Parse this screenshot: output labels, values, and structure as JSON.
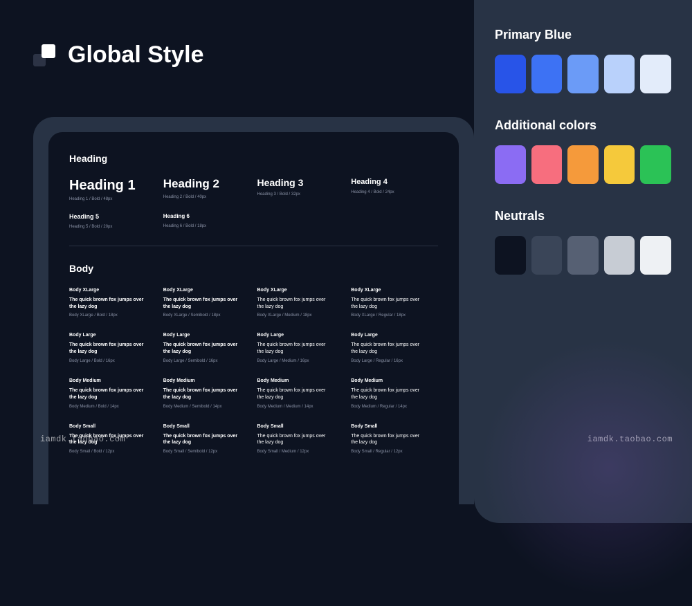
{
  "title": "Global Style",
  "watermark": "iamdk.taobao.com",
  "typography": {
    "heading_label": "Heading",
    "body_label": "Body",
    "headings": [
      {
        "sample": "Heading 1",
        "spec": "Heading 1 / Bold / 48px",
        "cls": "h1"
      },
      {
        "sample": "Heading 2",
        "spec": "Heading 2 / Bold / 40px",
        "cls": "h2"
      },
      {
        "sample": "Heading 3",
        "spec": "Heading 3 / Bold / 32px",
        "cls": "h3"
      },
      {
        "sample": "Heading 4",
        "spec": "Heading 4 / Bold / 24px",
        "cls": "h4"
      },
      {
        "sample": "Heading 5",
        "spec": "Heading 5 / Bold / 20px",
        "cls": "h5"
      },
      {
        "sample": "Heading 6",
        "spec": "Heading 6 / Bold / 18px",
        "cls": "h6"
      }
    ],
    "body_sample": "The quick brown fox jumps over the lazy dog",
    "body_rows": [
      {
        "label": "Body XLarge",
        "variants": [
          {
            "weight": "bold",
            "spec": "Body XLarge / Bold / 18px"
          },
          {
            "weight": "semibold",
            "spec": "Body XLarge / Semibold / 18px"
          },
          {
            "weight": "medium",
            "spec": "Body XLarge / Medium / 18px"
          },
          {
            "weight": "regular",
            "spec": "Body XLarge / Regular / 18px"
          }
        ]
      },
      {
        "label": "Body Large",
        "variants": [
          {
            "weight": "bold",
            "spec": "Body Large / Bold / 16px"
          },
          {
            "weight": "semibold",
            "spec": "Body Large / Semibold / 16px"
          },
          {
            "weight": "medium",
            "spec": "Body Large / Medium / 16px"
          },
          {
            "weight": "regular",
            "spec": "Body Large / Regular / 16px"
          }
        ]
      },
      {
        "label": "Body Medium",
        "variants": [
          {
            "weight": "bold",
            "spec": "Body Medium / Bold / 14px"
          },
          {
            "weight": "semibold",
            "spec": "Body Medium / Semibold / 14px"
          },
          {
            "weight": "medium",
            "spec": "Body Medium / Medium / 14px"
          },
          {
            "weight": "regular",
            "spec": "Body Medium / Regular / 14px"
          }
        ]
      },
      {
        "label": "Body Small",
        "variants": [
          {
            "weight": "bold",
            "spec": "Body Small / Bold / 12px"
          },
          {
            "weight": "semibold",
            "spec": "Body Small / Semibold / 12px"
          },
          {
            "weight": "medium",
            "spec": "Body Small / Medium / 12px"
          },
          {
            "weight": "regular",
            "spec": "Body Small / Regular / 12px"
          }
        ]
      }
    ]
  },
  "colors": {
    "sections": [
      {
        "title": "Primary Blue",
        "swatches": [
          "#2854e8",
          "#3d72f4",
          "#6b9bf7",
          "#b9d1fb",
          "#e3ecfa"
        ]
      },
      {
        "title": "Additional colors",
        "swatches": [
          "#8b6cf3",
          "#f76e7e",
          "#f59a3b",
          "#f5c93b",
          "#2bc256"
        ]
      },
      {
        "title": "Neutrals",
        "swatches": [
          "#0d1321",
          "#3a4558",
          "#566073",
          "#c7ccd4",
          "#eef1f4"
        ]
      }
    ]
  }
}
